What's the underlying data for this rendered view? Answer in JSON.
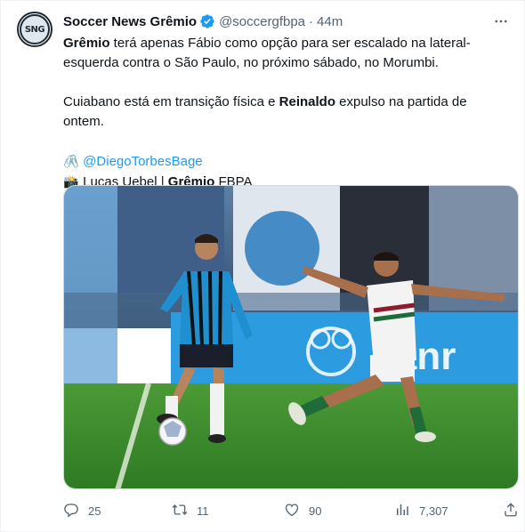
{
  "tweet": {
    "author": {
      "display_name": "Soccer News Grêmio",
      "handle": "@soccergfbpa",
      "time": "44m",
      "separator": "·",
      "avatar_text": "SNG",
      "verified": true
    },
    "body": {
      "p1_b1": "Grêmio",
      "p1_t1": " terá apenas Fábio como opção para ser escalado na lateral-esquerda contra o São Paulo, no próximo sábado, no Morumbi.",
      "p2_t1": "Cuiabano está em transição física e ",
      "p2_b1": "Reinaldo",
      "p2_t2": " expulso na partida de ontem.",
      "p3_emoji": "🖇️",
      "p3_link": "@DiegoTorbesBage",
      "p4_emoji": "📸",
      "p4_t1": "Lucas Uebel | ",
      "p4_b1": "Grêmio",
      "p4_t2": " FBPA"
    },
    "stats": {
      "replies": "25",
      "retweets": "11",
      "likes": "90",
      "views": "7,307"
    },
    "photo": {
      "banner_text": "banr",
      "player_left_team": "Grêmio",
      "player_right_team": "Fluminense"
    },
    "colors": {
      "accent": "#1d9bf0",
      "text": "#0f1419",
      "muted": "#536471",
      "gremio_blue": "#1f8fd0",
      "pitch_green": "#3e8a2e"
    },
    "icons": [
      "verified-badge-icon",
      "more-icon",
      "reply-icon",
      "retweet-icon",
      "like-icon",
      "views-icon",
      "share-icon",
      "paperclip-emoji",
      "camera-emoji"
    ]
  }
}
